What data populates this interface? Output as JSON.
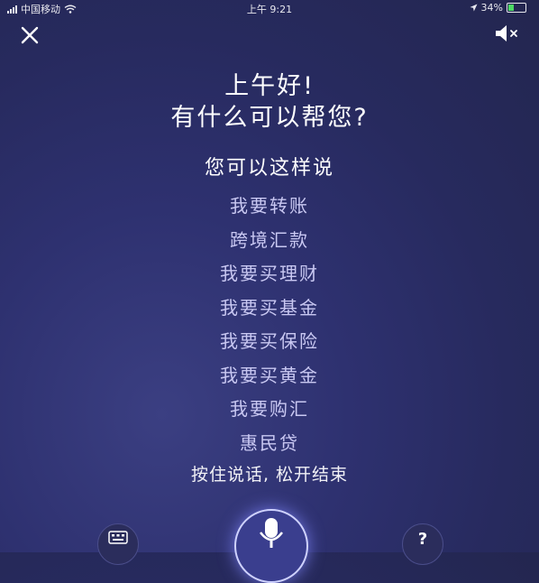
{
  "status_bar": {
    "carrier": "中国移动",
    "time": "上午 9:21",
    "battery_text": "34%",
    "battery_level": 0.34
  },
  "header": {
    "close_icon": "close-icon",
    "mute_icon": "speaker-mute-icon"
  },
  "main": {
    "greeting": "上午好!",
    "question": "有什么可以帮您?",
    "hint_title": "您可以这样说",
    "suggestions": [
      "我要转账",
      "跨境汇款",
      "我要买理财",
      "我要买基金",
      "我要买保险",
      "我要买黄金",
      "我要购汇",
      "惠民贷"
    ],
    "instruction": "按住说话, 松开结束"
  },
  "bottom": {
    "keyboard_icon": "keyboard-icon",
    "mic_icon": "microphone-icon",
    "help_label": "?"
  },
  "colors": {
    "background": "#272a5e",
    "suggestion_text": "#c9c8f2",
    "battery": "#4cd964"
  }
}
